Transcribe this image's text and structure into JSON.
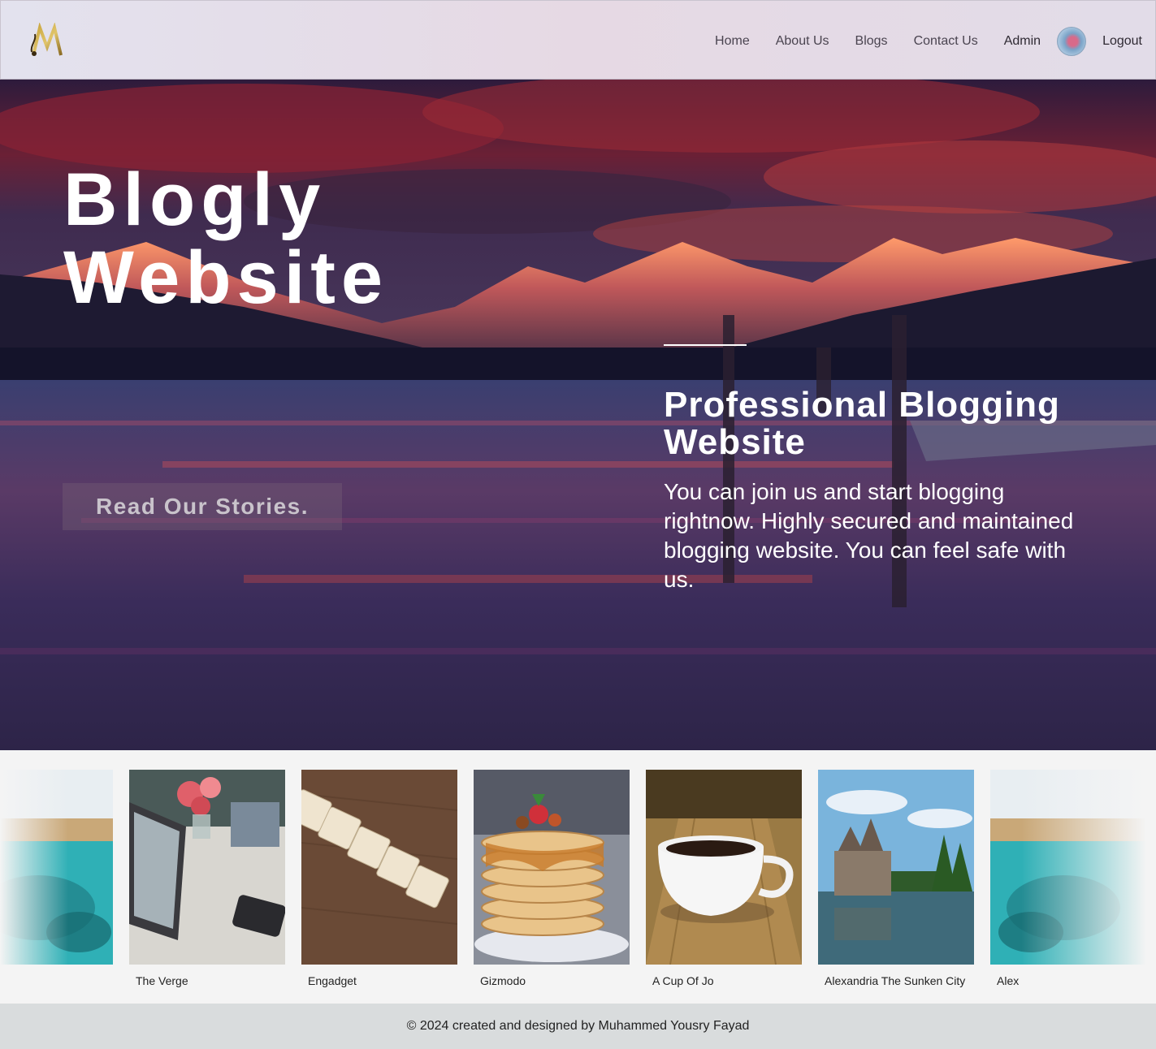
{
  "nav": {
    "links": [
      "Home",
      "About Us",
      "Blogs",
      "Contact Us"
    ],
    "admin_label": "Admin",
    "logout_label": "Logout"
  },
  "hero": {
    "title_line1": "Blogly",
    "title_line2": "Website",
    "cta_label": "Read Our Stories.",
    "feature_title": "Professional Blogging Website",
    "feature_text": "You can join us and start blogging rightnow. Highly secured and maintained blogging website. You can feel safe with us."
  },
  "gallery": {
    "cards": [
      {
        "caption": "",
        "image": "underwater-ruins"
      },
      {
        "caption": "The Verge",
        "image": "laptop-flowers-desk"
      },
      {
        "caption": "Engadget",
        "image": "scrabble-blog-tiles"
      },
      {
        "caption": "Gizmodo",
        "image": "pancake-stack"
      },
      {
        "caption": "A Cup Of Jo",
        "image": "coffee-cup"
      },
      {
        "caption": "Alexandria The Sunken City",
        "image": "castle-on-lake"
      },
      {
        "caption": "Alex",
        "image": "underwater-ruins"
      }
    ]
  },
  "footer": {
    "text": "© 2024 created and designed by Muhammed Yousry Fayad"
  },
  "colors": {
    "navbar_bg": "#e4dde9",
    "footer_bg": "#d9dcdd",
    "hero_text": "#ffffff"
  }
}
